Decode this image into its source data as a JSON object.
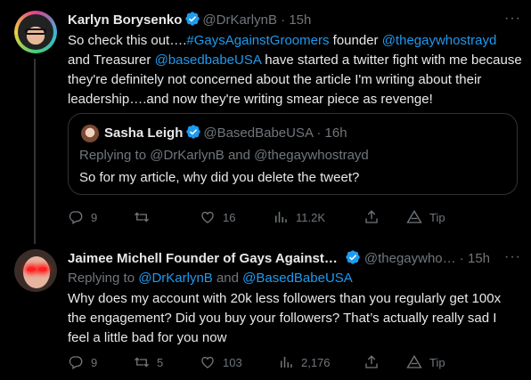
{
  "tweet1": {
    "author_name": "Karlyn Borysenko",
    "author_handle": "@DrKarlynB",
    "time": "15h",
    "more": "···",
    "body": [
      {
        "text": "So check this out….",
        "link": false
      },
      {
        "text": "#GaysAgainstGroomers",
        "link": true
      },
      {
        "text": " founder ",
        "link": false
      },
      {
        "text": "@thegaywhostrayd",
        "link": true
      },
      {
        "text": " and Treasurer ",
        "link": false
      },
      {
        "text": "@basedbabeUSA",
        "link": true
      },
      {
        "text": " have started a twitter fight with me because they're definitely not concerned about the article I'm writing about their leadership….and now they're writing smear piece as revenge!",
        "link": false
      }
    ],
    "quote": {
      "author_name": "Sasha Leigh",
      "author_handle": "@BasedBabeUSA",
      "time": "16h",
      "replying": "Replying to @DrKarlynB and @thegaywhostrayd",
      "body": "So for my article, why did you delete the tweet?"
    },
    "actions": {
      "replies": "9",
      "retweets": "",
      "likes": "16",
      "views": "11.2K",
      "tip": "Tip"
    }
  },
  "tweet2": {
    "author_name": "Jaimee Michell Founder of Gays Against…",
    "author_handle": "@thegaywho…",
    "time": "15h",
    "more": "···",
    "replying_prefix": "Replying to ",
    "replying_user1": "@DrKarlynB",
    "replying_and": " and ",
    "replying_user2": "@BasedBabeUSA",
    "body": "Why does my account with 20k less followers than you regularly get 100x the engagement? Did you buy your followers? That’s actually really sad I feel a little bad for you now",
    "actions": {
      "replies": "9",
      "retweets": "5",
      "likes": "103",
      "views": "2,176",
      "tip": "Tip"
    }
  },
  "colors": {
    "background": "#000000",
    "text": "#e7e9ea",
    "muted": "#71767b",
    "link": "#1d9bf0",
    "border": "#2f3336"
  },
  "icons": [
    "reply-icon",
    "retweet-icon",
    "like-icon",
    "views-icon",
    "share-icon",
    "tip-icon",
    "verified-icon"
  ]
}
